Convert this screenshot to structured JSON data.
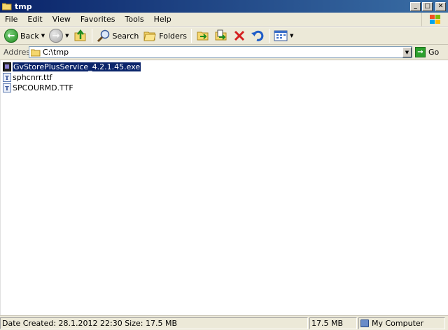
{
  "window": {
    "title": "tmp",
    "buttons": {
      "minimize": "_",
      "maximize": "□",
      "close": "✕"
    }
  },
  "menu": {
    "items": [
      "File",
      "Edit",
      "View",
      "Favorites",
      "Tools",
      "Help"
    ]
  },
  "toolbar": {
    "back_label": "Back",
    "search_label": "Search",
    "folders_label": "Folders",
    "icons": [
      "back-arrow-icon",
      "forward-arrow-icon",
      "up-folder-icon",
      "search-icon",
      "folders-icon",
      "move-to-icon",
      "copy-to-icon",
      "delete-icon",
      "undo-icon",
      "views-icon"
    ]
  },
  "address": {
    "label": "Address",
    "value": "C:\\tmp",
    "go_label": "Go"
  },
  "files": [
    {
      "name": "GvStorePlusService_4.2.1.45.exe",
      "type": "exe",
      "selected": true
    },
    {
      "name": "sphcnrr.ttf",
      "type": "ttf",
      "selected": false
    },
    {
      "name": "SPCOURMD.TTF",
      "type": "ttf",
      "selected": false
    }
  ],
  "status": {
    "details": "Date Created: 28.1.2012 22:30 Size: 17.5 MB",
    "size": "17.5 MB",
    "zone": "My Computer"
  },
  "colors": {
    "titlebar": "#0a246a",
    "selection": "#0a246a",
    "chrome": "#ece9d8"
  }
}
